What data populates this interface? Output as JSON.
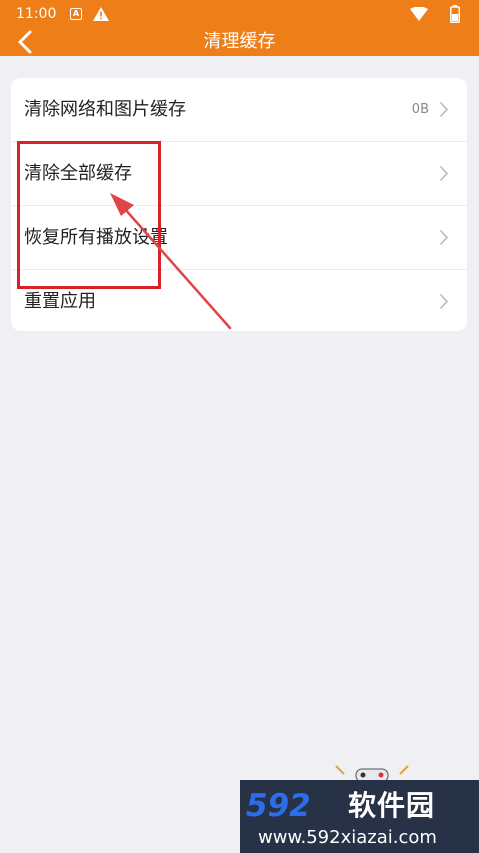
{
  "status_bar": {
    "time": "11:00",
    "notification_letter": "A"
  },
  "app_bar": {
    "title": "清理缓存"
  },
  "settings": {
    "items": [
      {
        "label": "清除网络和图片缓存",
        "value": "0B"
      },
      {
        "label": "清除全部缓存",
        "value": ""
      },
      {
        "label": "恢复所有播放设置",
        "value": ""
      },
      {
        "label": "重置应用",
        "value": ""
      }
    ]
  },
  "watermark": {
    "brand_number": "592",
    "brand_name": "软件园",
    "url": "www.592xiazai.com"
  },
  "colors": {
    "accent": "#ed7e18",
    "highlight": "#d92228",
    "background": "#efeff4",
    "watermark_bg": "#283246",
    "watermark_blue": "#2c6ee8"
  }
}
